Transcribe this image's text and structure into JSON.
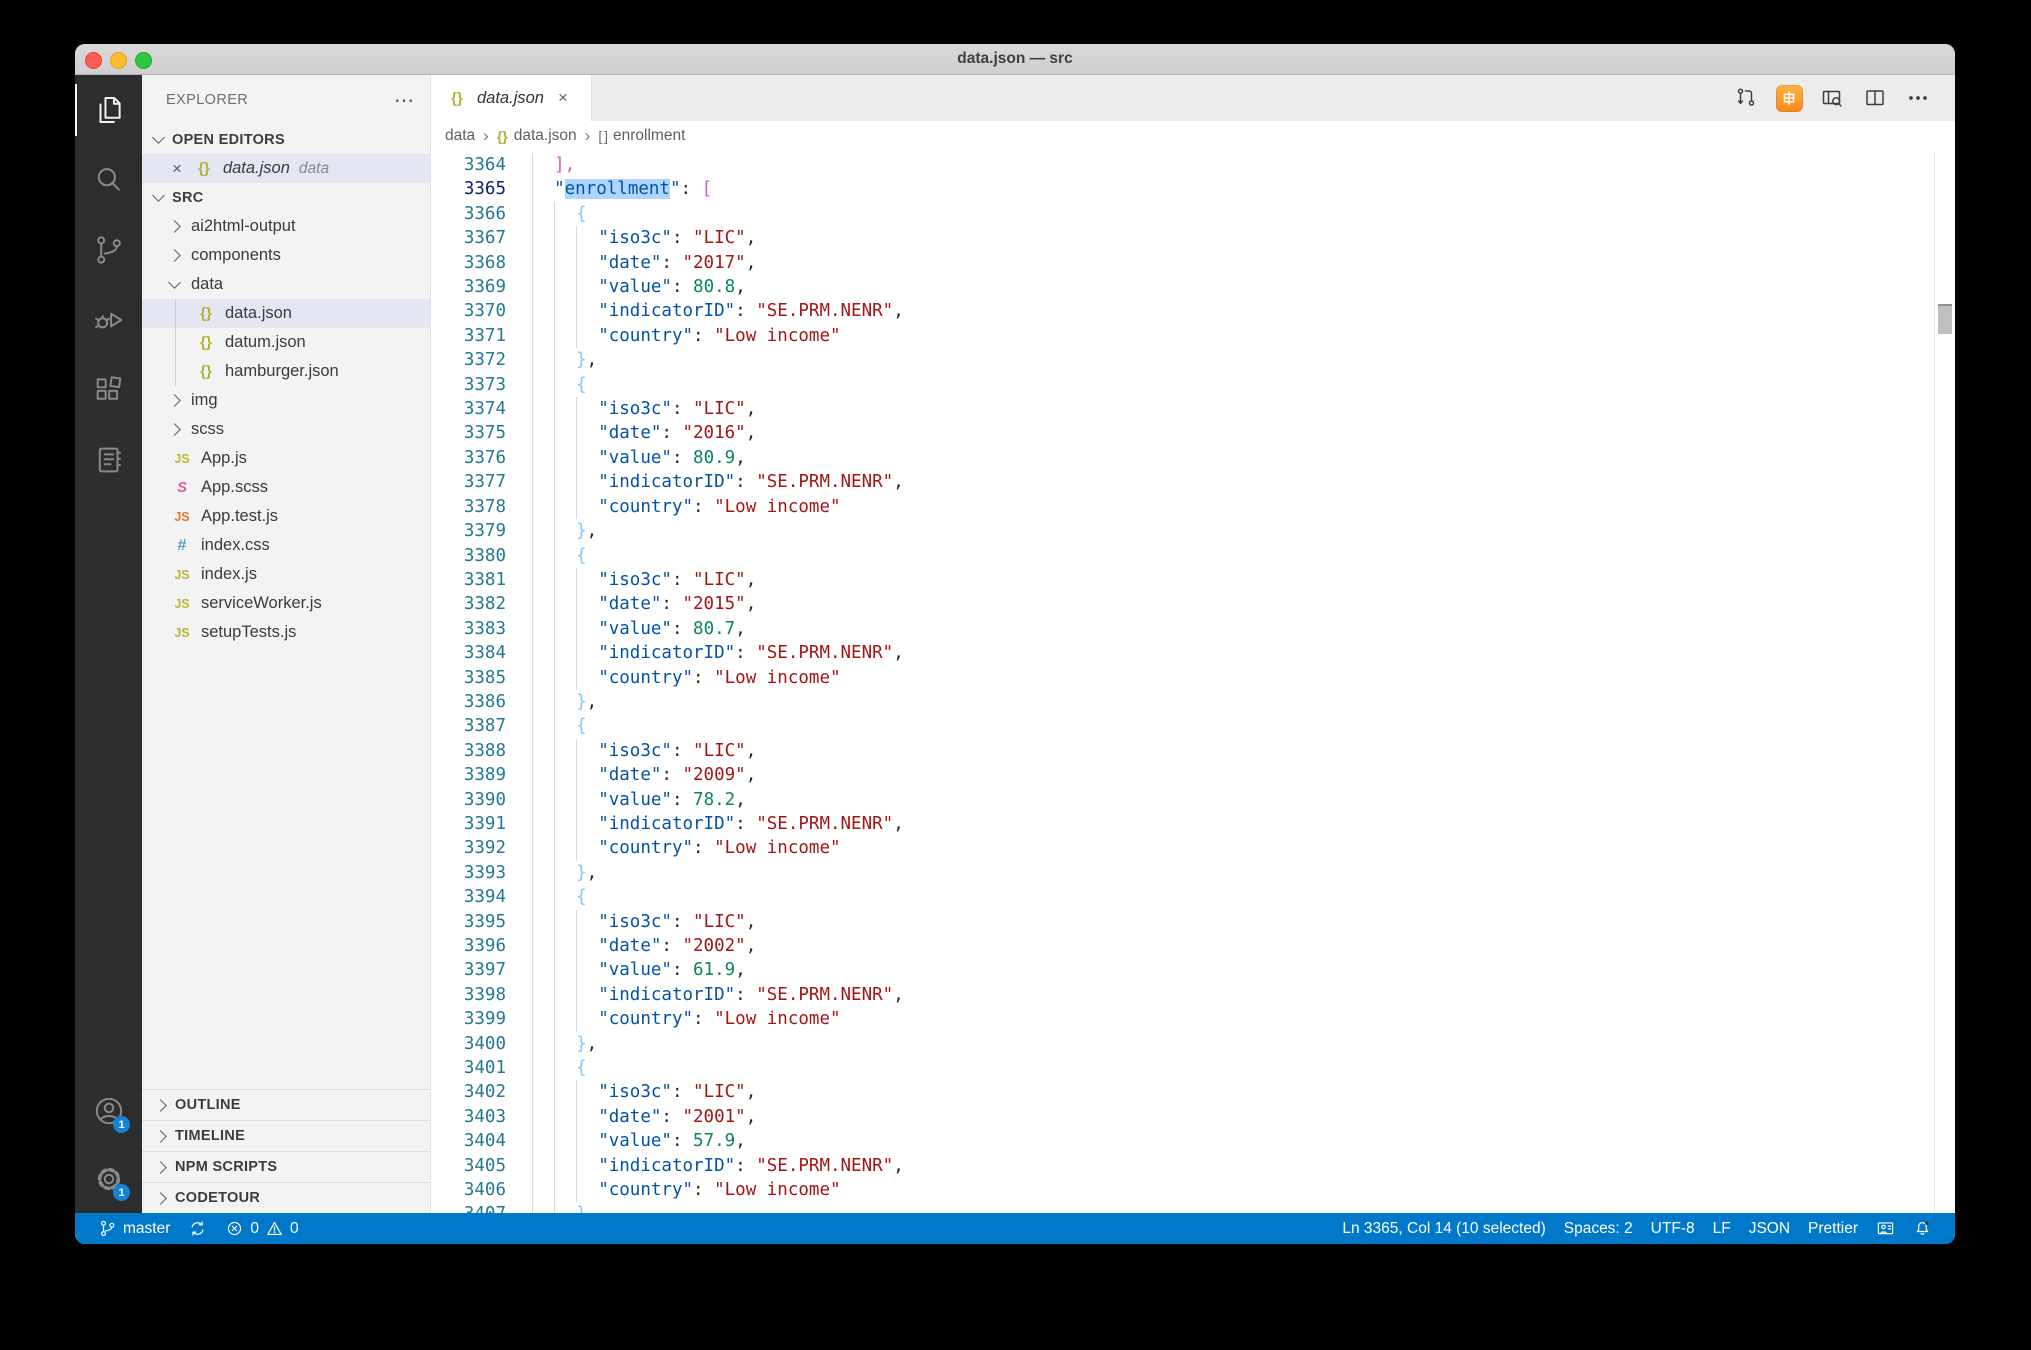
{
  "window": {
    "title": "data.json — src"
  },
  "activity_bar": {
    "items": [
      {
        "name": "explorer",
        "active": true
      },
      {
        "name": "search",
        "active": false
      },
      {
        "name": "source-control",
        "active": false
      },
      {
        "name": "run-debug",
        "active": false
      },
      {
        "name": "extensions",
        "active": false
      },
      {
        "name": "notebook",
        "active": false
      }
    ],
    "bottom": [
      {
        "name": "account",
        "badge": "1"
      },
      {
        "name": "settings",
        "badge": "1"
      }
    ]
  },
  "sidebar": {
    "header": "EXPLORER",
    "more_label": "⋯",
    "open_editors": {
      "label": "OPEN EDITORS",
      "items": [
        {
          "icon": "json",
          "name": "data.json",
          "desc": "data",
          "selected": true,
          "italic": true
        }
      ]
    },
    "src": {
      "label": "SRC",
      "items": [
        {
          "kind": "folder",
          "name": "ai2html-output",
          "expanded": false,
          "level": 0
        },
        {
          "kind": "folder",
          "name": "components",
          "expanded": false,
          "level": 0
        },
        {
          "kind": "folder",
          "name": "data",
          "expanded": true,
          "level": 0
        },
        {
          "kind": "file",
          "icon": "json",
          "name": "data.json",
          "level": 1,
          "selected": true
        },
        {
          "kind": "file",
          "icon": "json",
          "name": "datum.json",
          "level": 1
        },
        {
          "kind": "file",
          "icon": "json",
          "name": "hamburger.json",
          "level": 1
        },
        {
          "kind": "folder",
          "name": "img",
          "expanded": false,
          "level": 0
        },
        {
          "kind": "folder",
          "name": "scss",
          "expanded": false,
          "level": 0
        },
        {
          "kind": "file",
          "icon": "js",
          "name": "App.js",
          "level": 0
        },
        {
          "kind": "file",
          "icon": "scss",
          "name": "App.scss",
          "level": 0
        },
        {
          "kind": "file",
          "icon": "jstest",
          "name": "App.test.js",
          "level": 0
        },
        {
          "kind": "file",
          "icon": "css",
          "name": "index.css",
          "level": 0
        },
        {
          "kind": "file",
          "icon": "js",
          "name": "index.js",
          "level": 0
        },
        {
          "kind": "file",
          "icon": "js",
          "name": "serviceWorker.js",
          "level": 0
        },
        {
          "kind": "file",
          "icon": "js",
          "name": "setupTests.js",
          "level": 0
        }
      ]
    },
    "panels": [
      "OUTLINE",
      "TIMELINE",
      "NPM SCRIPTS",
      "CODETOUR"
    ]
  },
  "tabs": [
    {
      "icon": "json",
      "name": "data.json",
      "close": "×",
      "active": true,
      "preview": true
    }
  ],
  "editor_actions": [
    {
      "name": "compare-changes"
    },
    {
      "name": "cjk-extension"
    },
    {
      "name": "open-preview"
    },
    {
      "name": "split-editor"
    },
    {
      "name": "more-actions"
    }
  ],
  "breadcrumb": [
    {
      "label": "data",
      "icon": null
    },
    {
      "label": "data.json",
      "icon": "json"
    },
    {
      "label": "enrollment",
      "icon": "array"
    }
  ],
  "editor": {
    "first_line": 3364,
    "active_line": 3365,
    "selected_word": "enrollment",
    "array_key": "enrollment",
    "entries": [
      {
        "iso3c": "LIC",
        "date": "2017",
        "value": "80.8",
        "indicatorID": "SE.PRM.NENR",
        "country": "Low income"
      },
      {
        "iso3c": "LIC",
        "date": "2016",
        "value": "80.9",
        "indicatorID": "SE.PRM.NENR",
        "country": "Low income"
      },
      {
        "iso3c": "LIC",
        "date": "2015",
        "value": "80.7",
        "indicatorID": "SE.PRM.NENR",
        "country": "Low income"
      },
      {
        "iso3c": "LIC",
        "date": "2009",
        "value": "78.2",
        "indicatorID": "SE.PRM.NENR",
        "country": "Low income"
      },
      {
        "iso3c": "LIC",
        "date": "2002",
        "value": "61.9",
        "indicatorID": "SE.PRM.NENR",
        "country": "Low income"
      },
      {
        "iso3c": "LIC",
        "date": "2001",
        "value": "57.9",
        "indicatorID": "SE.PRM.NENR",
        "country": "Low income"
      }
    ]
  },
  "status_bar": {
    "left": [
      {
        "icon": "branch",
        "label": "master"
      },
      {
        "icon": "sync",
        "label": ""
      },
      {
        "icon": "error",
        "label": "0",
        "icon2": "warning",
        "label2": "0"
      }
    ],
    "right": [
      {
        "label": "Ln 3365, Col 14 (10 selected)"
      },
      {
        "label": "Spaces: 2"
      },
      {
        "label": "UTF-8"
      },
      {
        "label": "LF"
      },
      {
        "label": "JSON"
      },
      {
        "label": "Prettier"
      },
      {
        "icon": "feedback"
      },
      {
        "icon": "bell"
      }
    ]
  },
  "colors": {
    "status_bg": "#0179cb",
    "selection": "#add6ff",
    "key": "#0451a5",
    "string": "#a31515",
    "number": "#098658",
    "bracket_orchid": "#d856d0",
    "bracket_sky": "#84c6f8"
  }
}
